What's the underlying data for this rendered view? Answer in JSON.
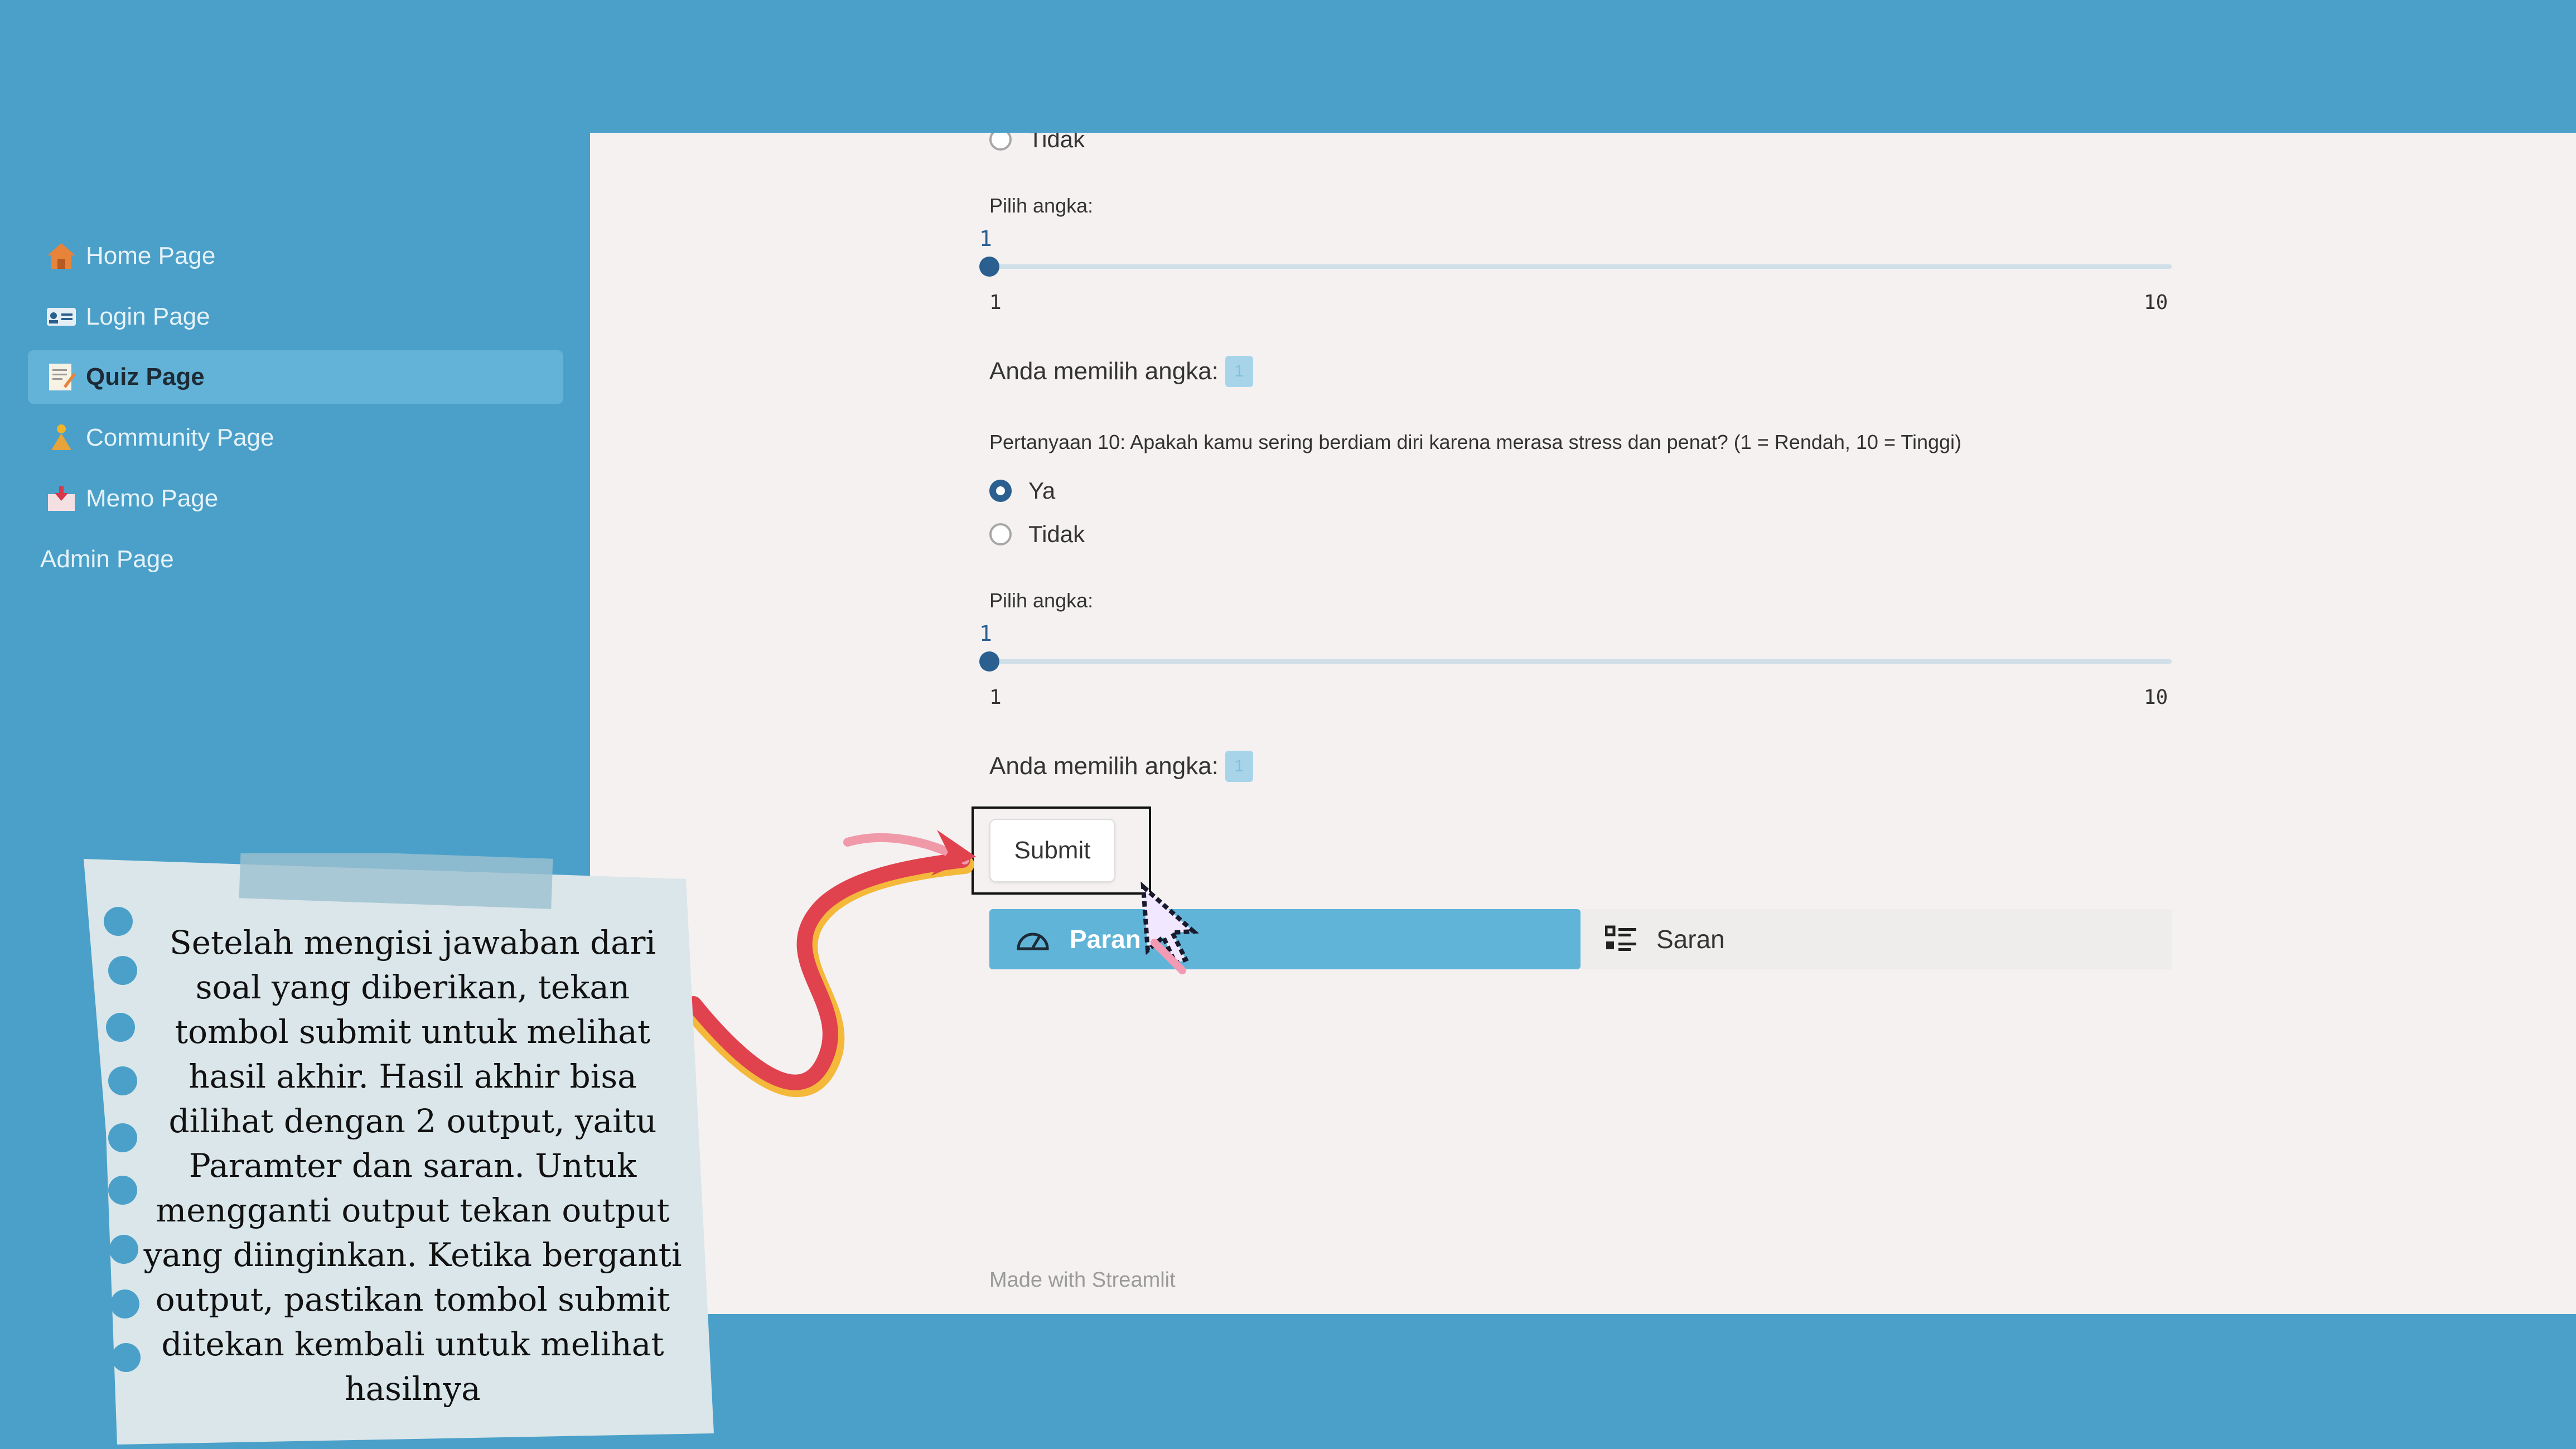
{
  "sidebar": {
    "items": [
      {
        "label": "Home Page",
        "icon": "house-icon"
      },
      {
        "label": "Login Page",
        "icon": "id-card-icon"
      },
      {
        "label": "Quiz Page",
        "icon": "memo-icon",
        "active": true
      },
      {
        "label": "Community Page",
        "icon": "people-icon"
      },
      {
        "label": "Memo Page",
        "icon": "inbox-icon"
      },
      {
        "label": "Admin Page"
      }
    ]
  },
  "quiz": {
    "prev_option": "Tidak",
    "slider1": {
      "label": "Pilih angka:",
      "value": "1",
      "min": "1",
      "max": "10"
    },
    "result1": {
      "label": "Anda memilih angka:",
      "value": "1"
    },
    "question10": "Pertanyaan 10: Apakah kamu sering berdiam diri karena merasa stress dan penat? (1 = Rendah, 10 = Tinggi)",
    "options": [
      {
        "label": "Ya",
        "selected": true
      },
      {
        "label": "Tidak",
        "selected": false
      }
    ],
    "slider2": {
      "label": "Pilih angka:",
      "value": "1",
      "min": "1",
      "max": "10"
    },
    "result2": {
      "label": "Anda memilih angka:",
      "value": "1"
    },
    "submit_label": "Submit"
  },
  "tabs": [
    {
      "label": "Paran",
      "icon": "gauge-icon",
      "active": true
    },
    {
      "label": "Saran",
      "icon": "checklist-icon",
      "active": false
    }
  ],
  "footer": "Made with Streamlit",
  "note": "Setelah mengisi jawaban dari soal yang diberikan, tekan tombol submit untuk melihat hasil akhir. Hasil akhir bisa dilihat dengan 2 output, yaitu Paramter dan saran. Untuk mengganti output tekan output yang diinginkan. Ketika berganti output, pastikan tombol submit ditekan kembali untuk melihat hasilnya",
  "colors": {
    "background": "#4aa0c9",
    "main": "#f5f1f1",
    "accent": "#2a5f8f",
    "tab_active": "#5fb4d8",
    "arrow": "#e0424e"
  }
}
